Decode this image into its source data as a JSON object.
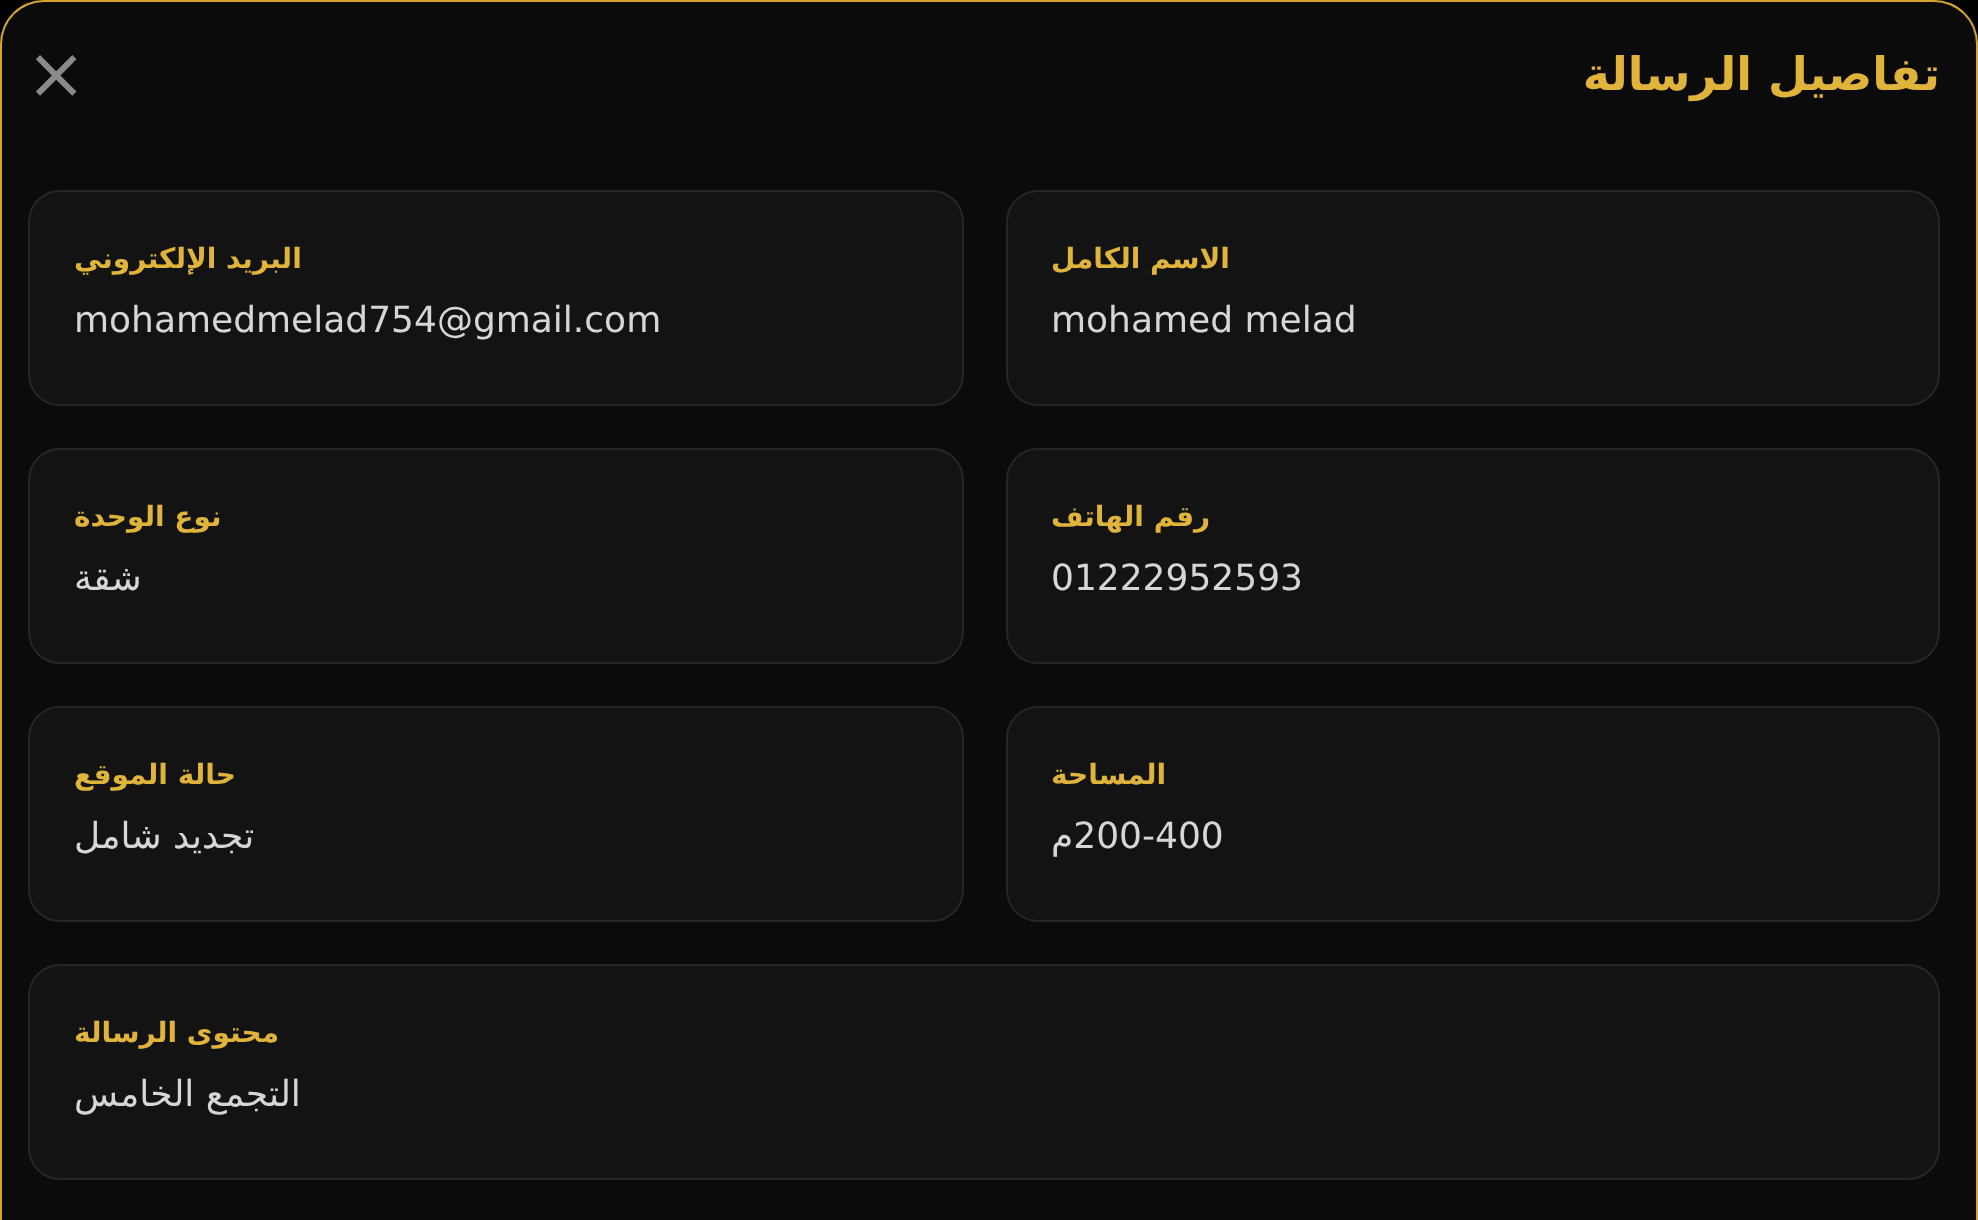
{
  "dialog": {
    "title": "تفاصيل الرسالة",
    "close": "×"
  },
  "fields": [
    {
      "label": "الاسم الكامل",
      "value": "mohamed melad",
      "wide": false
    },
    {
      "label": "البريد الإلكتروني",
      "value": "mohamedmelad754@gmail.com",
      "wide": false
    },
    {
      "label": "رقم الهاتف",
      "value": "01222952593",
      "wide": false
    },
    {
      "label": "نوع الوحدة",
      "value": "شقة",
      "wide": false
    },
    {
      "label": "المساحة",
      "value": "200-400م",
      "wide": false
    },
    {
      "label": "حالة الموقع",
      "value": "تجديد شامل",
      "wide": false
    },
    {
      "label": "محتوى الرسالة",
      "value": "التجمع الخامس",
      "wide": true
    }
  ]
}
